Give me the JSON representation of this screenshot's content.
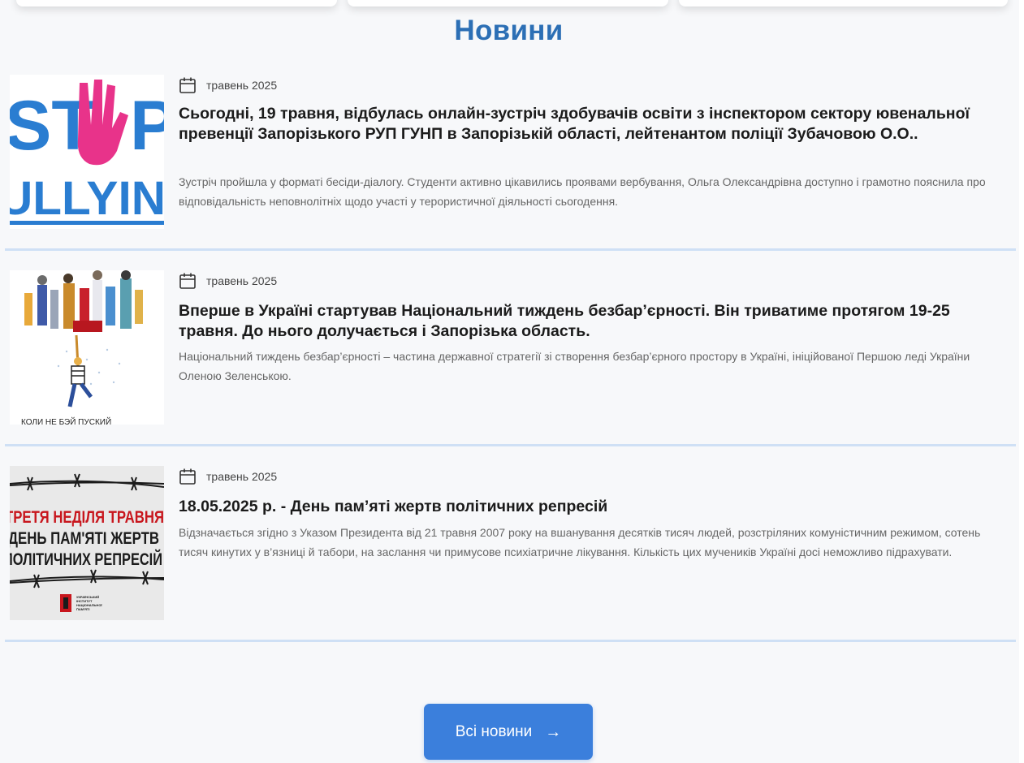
{
  "section": {
    "title": "Новини"
  },
  "news": [
    {
      "date": "травень 2025",
      "title": "Сьогодні, 19 травня, відбулась онлайн-зустріч здобувачів освіти з інспектором сектору ювенальної превенції Запорізького РУП ГУНП в Запорізькій області, лейтенантом поліції Зубачовою О.О..",
      "excerpt": "Зустріч пройшла у форматі бесіди-діалогу. Студенти активно цікавились проявами вербування, Ольга Олександрівна доступно і грамотно пояснила про відповідальність неповнолітніх щодо участі у терористичної діяльності сьогодення.",
      "image": {
        "text_top": "ST",
        "text_top_right": "P",
        "text_bottom": "ULLYIN"
      }
    },
    {
      "date": "травень 2025",
      "title": "Вперше в Україні стартував Національний тиждень безбар’єрності. Він триватиме протягом 19-25 травня. До нього долучається і Запорізька область.",
      "excerpt": "Національний тиждень безбар’єрності – частина державної стратегії зі створення безбар’єрного простору в Україні, ініційованої Першою леді України Оленою Зеленською.",
      "image": {
        "caption": "КОЛИ НЕ БЭЙ ПУСКИЙ"
      }
    },
    {
      "date": "травень 2025",
      "title": "18.05.2025 р. - День пам’яті жертв політичних репресій",
      "excerpt": "Відзначається згідно з Указом Президента від 21 травня 2007 року на вшанування десятків тисяч людей, розстріляних комуністичним режимом, сотень тисяч кинутих у в’язниці й табори, на заслання чи примусове психіатричне лікування. Кількість цих мучеників Україні досі неможливо підрахувати.",
      "image": {
        "line1": "ТРЕТЯ НЕДІЛЯ ТРАВНЯ",
        "line2": "ДЕНЬ ПАМ'ЯТІ ЖЕРТВ",
        "line3": "ПОЛІТИЧНИХ РЕПРЕСІЙ",
        "logo_line1": "УКРАЇНСЬКИЙ",
        "logo_line2": "ІНСТИТУТ",
        "logo_line3": "НАЦІОНАЛЬНОЇ",
        "logo_line4": "ПАМ'ЯТІ"
      }
    }
  ],
  "all_news_button": {
    "label": "Всі новини",
    "icon": "arrow-right-icon"
  },
  "colors": {
    "accent": "#3b7fdc",
    "title": "#2c6fb5",
    "divider": "#cfe0f5",
    "stop_blue": "#2a7dd1",
    "stop_pink": "#e8338a",
    "repression_red": "#c8161d"
  }
}
